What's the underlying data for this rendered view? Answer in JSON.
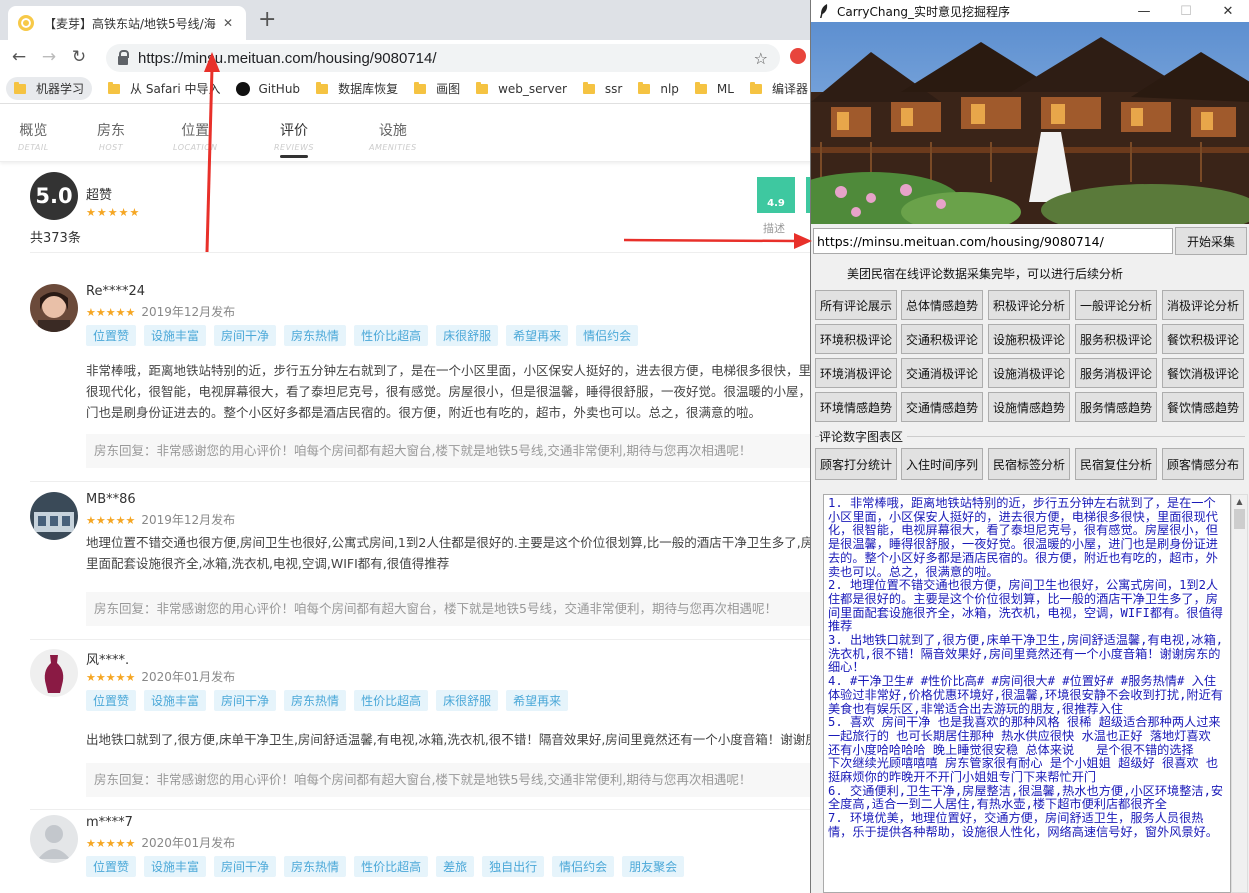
{
  "browser": {
    "tab_title": "【麦芽】高铁东站/地铁5号线/海",
    "url": "https://minsu.meituan.com/housing/9080714/",
    "bookmarks": [
      "机器学习",
      "从 Safari 中导入",
      "GitHub",
      "数据库恢复",
      "画图",
      "web_server",
      "ssr",
      "nlp",
      "ML",
      "编译器"
    ]
  },
  "page": {
    "nav": [
      {
        "cn": "概览",
        "en": "DETAIL"
      },
      {
        "cn": "房东",
        "en": "HOST"
      },
      {
        "cn": "位置",
        "en": "LOCATION"
      },
      {
        "cn": "评价",
        "en": "REVIEWS"
      },
      {
        "cn": "设施",
        "en": "AMENITIES"
      }
    ],
    "score": "5.0",
    "score_word": "超赞",
    "stars": "★★★★★",
    "total_count": "共373条",
    "subscore_value": "4.9",
    "subscore_label": "描述",
    "reviews": [
      {
        "name": "Re****24",
        "date": "2019年12月发布",
        "tags": [
          "位置赞",
          "设施丰富",
          "房间干净",
          "房东热情",
          "性价比超高",
          "床很舒服",
          "希望再来",
          "情侣约会"
        ],
        "text": "非常棒哦，距离地铁站特别的近，步行五分钟左右就到了，是在一个小区里面，小区保安人挺好的，进去很方便，电梯很多很快，里面很现代化，很智能，电视屏幕很大，看了泰坦尼克号，很有感觉。房屋很小，但是很温馨，睡得很舒服，一夜好觉。很温暖的小屋，进门也是刷身份证进去的。整个小区好多都是酒店民宿的。很方便，附近也有吃的，超市，外卖也可以。总之，很满意的啦。",
        "reply": "房东回复：非常感谢您的用心评价！咱每个房间都有超大窗台,楼下就是地铁5号线,交通非常便利,期待与您再次相遇呢！"
      },
      {
        "name": "MB**86",
        "date": "2019年12月发布",
        "tags": [],
        "text": "地理位置不错交通也很方便,房间卫生也很好,公寓式房间,1到2人住都是很好的.主要是这个价位很划算,比一般的酒店干净卫生多了,房间里面配套设施很齐全,冰箱,洗衣机,电视,空调,WIFI都有,很值得推荐",
        "reply": "房东回复：非常感谢您的用心评价！咱每个房间都有超大窗台，楼下就是地铁5号线，交通非常便利，期待与您再次相遇呢！"
      },
      {
        "name": "风****.",
        "date": "2020年01月发布",
        "tags": [
          "位置赞",
          "设施丰富",
          "房间干净",
          "房东热情",
          "性价比超高",
          "床很舒服",
          "希望再来"
        ],
        "text": "出地铁口就到了,很方便,床单干净卫生,房间舒适温馨,有电视,冰箱,洗衣机,很不错！隔音效果好,房间里竟然还有一个小度音箱！谢谢房东的细心！",
        "reply": "房东回复：非常感谢您的用心评价！咱每个房间都有超大窗台,楼下就是地铁5号线,交通非常便利,期待与您再次相遇呢！"
      },
      {
        "name": "m****7",
        "date": "2020年01月发布",
        "tags": [
          "位置赞",
          "设施丰富",
          "房间干净",
          "房东热情",
          "性价比超高",
          "差旅",
          "独自出行",
          "情侣约会",
          "朋友聚会"
        ],
        "text": "",
        "reply": ""
      }
    ]
  },
  "app": {
    "title": "CarryChang_实时意见挖掘程序",
    "url_value": "https://minsu.meituan.com/housing/9080714/",
    "start_button": "开始采集",
    "status": "美团民宿在线评论数据采集完毕，可以进行后续分析",
    "buttons": [
      [
        "所有评论展示",
        "总体情感趋势",
        "积极评论分析",
        "一般评论分析",
        "消极评论分析"
      ],
      [
        "环境积极评论",
        "交通积极评论",
        "设施积极评论",
        "服务积极评论",
        "餐饮积极评论"
      ],
      [
        "环境消极评论",
        "交通消极评论",
        "设施消极评论",
        "服务消极评论",
        "餐饮消极评论"
      ],
      [
        "环境情感趋势",
        "交通情感趋势",
        "设施情感趋势",
        "服务情感趋势",
        "餐饮情感趋势"
      ]
    ],
    "chart_group_label": "评论数字图表区",
    "chart_buttons": [
      "顾客打分统计",
      "入住时间序列",
      "民宿标签分析",
      "民宿复住分析",
      "顾客情感分布"
    ],
    "output_text": "1. 非常棒哦，距离地铁站特别的近，步行五分钟左右就到了，是在一个小区里面，小区保安人挺好的，进去很方便，电梯很多很快，里面很现代化，很智能，电视屏幕很大，看了泰坦尼克号，很有感觉。房屋很小，但是很温馨，睡得很舒服，一夜好觉。很温暖的小屋，进门也是刷身份证进去的。整个小区好多都是酒店民宿的。很方便，附近也有吃的，超市，外卖也可以。总之，很满意的啦。\n2. 地理位置不错交通也很方便，房间卫生也很好，公寓式房间，1到2人住都是很好的。主要是这个价位很划算，比一般的酒店干净卫生多了，房间里面配套设施很齐全，冰箱，洗衣机，电视，空调，WIFI都有。很值得推荐\n3. 出地铁口就到了,很方便,床单干净卫生,房间舒适温馨,有电视,冰箱,洗衣机,很不错！隔音效果好,房间里竟然还有一个小度音箱！谢谢房东的细心！\n4. #干净卫生# #性价比高# #房间很大# #位置好# #服务热情# 入住体验过非常好,价格优惠环境好,很温馨,环境很安静不会收到打扰,附近有美食也有娱乐区,非常适合出去游玩的朋友,很推荐入住\n5. 喜欢 房间干净 也是我喜欢的那种风格 很稀 超级适合那种两人过来一起旅行的 也可长期居住那种 热水供应很快 水温也正好 落地灯喜欢 还有小度哈哈哈哈 晚上睡觉很安稳 总体来说   是个很不错的选择      下次继续光顾嘻嘻嘻 房东管家很有耐心 是个小姐姐 超级好 很喜欢 也挺麻烦你的昨晚开不开门小姐姐专门下来帮忙开门\n6. 交通便利,卫生干净,房屋整洁,很温馨,热水也方便,小区环境整洁,安全度高,适合一到二人居住,有热水壶,楼下超市便利店都很齐全\n7. 环境优美，地理位置好，交通方便，房间舒适卫生，服务人员很热情，乐于提供各种帮助，设施很人性化，网络高速信号好，窗外风景好。"
  },
  "colors": {
    "accent_tag_bg": "#e6f4fb",
    "accent_tag_text": "#4ba8d8",
    "star": "#f5a623",
    "subscore": "#3ec8a0",
    "output_text": "#1a1ab8",
    "annotation_arrow": "#e8302a"
  },
  "icons": [
    "back-arrow-icon",
    "forward-arrow-icon",
    "reload-icon",
    "lock-icon",
    "star-bookmark-icon",
    "folder-icon",
    "github-icon",
    "feather-icon",
    "minimize-icon",
    "maximize-icon",
    "close-icon"
  ]
}
